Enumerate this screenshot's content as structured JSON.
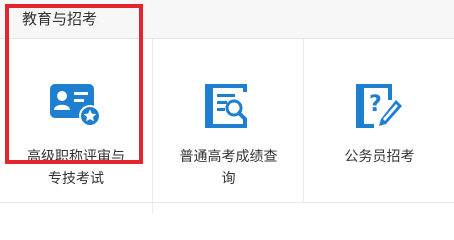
{
  "section": {
    "title": "教育与招考"
  },
  "tiles": [
    {
      "label_line1": "高级职称评审与",
      "label_line2": "专技考试",
      "icon": "certificate-id-card-icon",
      "selected": true
    },
    {
      "label_line1": "普通高考成绩查",
      "label_line2": "询",
      "icon": "score-search-document-icon",
      "selected": false
    },
    {
      "label_line1": "公务员招考",
      "label_line2": "",
      "icon": "exam-question-pen-icon",
      "selected": false
    }
  ],
  "colors": {
    "icon_blue": "#1e7fd1",
    "highlight_red": "#e3262e",
    "text": "#333333",
    "header_bg": "#f7f7f7"
  }
}
